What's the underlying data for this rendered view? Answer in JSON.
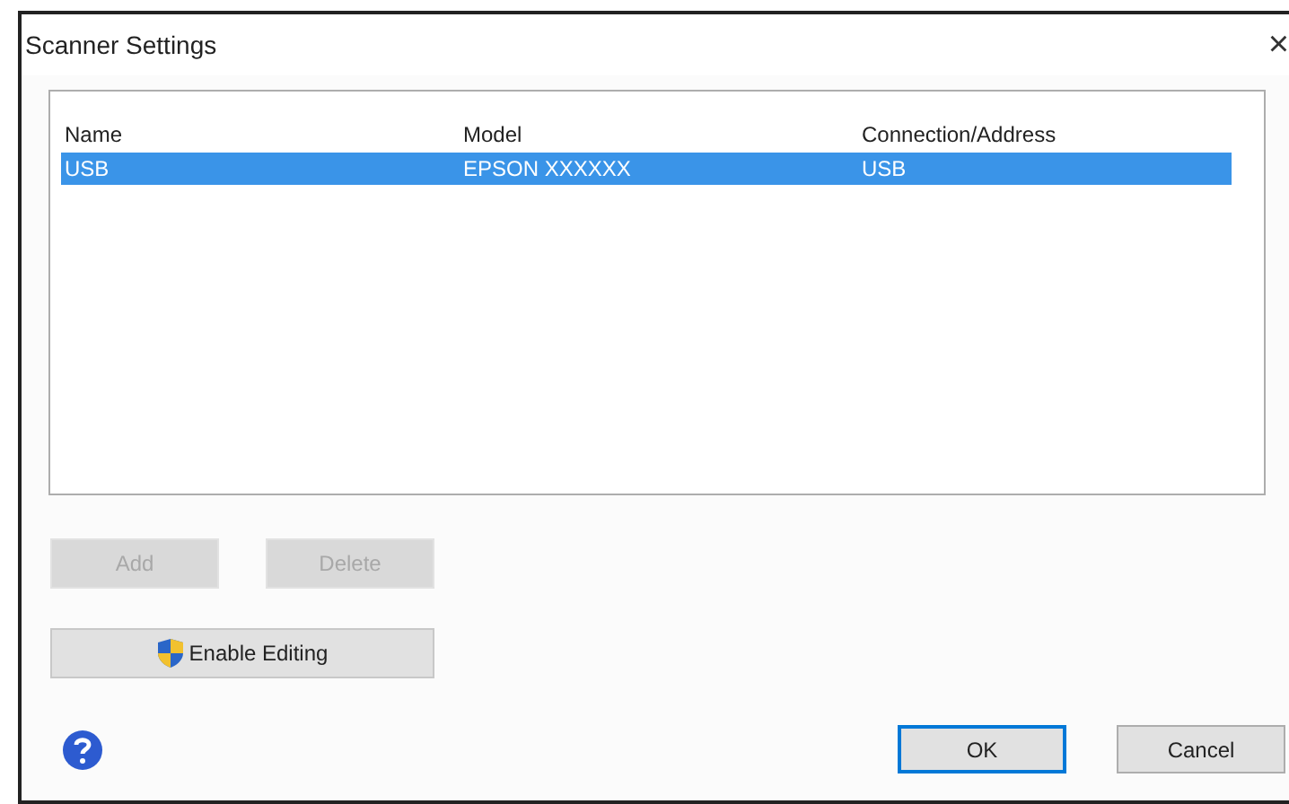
{
  "window": {
    "title": "Scanner Settings",
    "close": "×"
  },
  "table": {
    "columns": [
      "Name",
      "Model",
      "Connection/Address"
    ],
    "rows": [
      {
        "cells": [
          "USB",
          "EPSON XXXXXX",
          "USB"
        ],
        "selected": true
      }
    ]
  },
  "list_buttons": [
    {
      "label": "Add",
      "disabled": true
    },
    {
      "label": "Delete",
      "disabled": true
    }
  ],
  "enable_editing": {
    "label": "Enable Editing"
  },
  "footer_buttons": [
    {
      "label": "OK",
      "default": true
    },
    {
      "label": "Cancel",
      "default": false
    }
  ]
}
